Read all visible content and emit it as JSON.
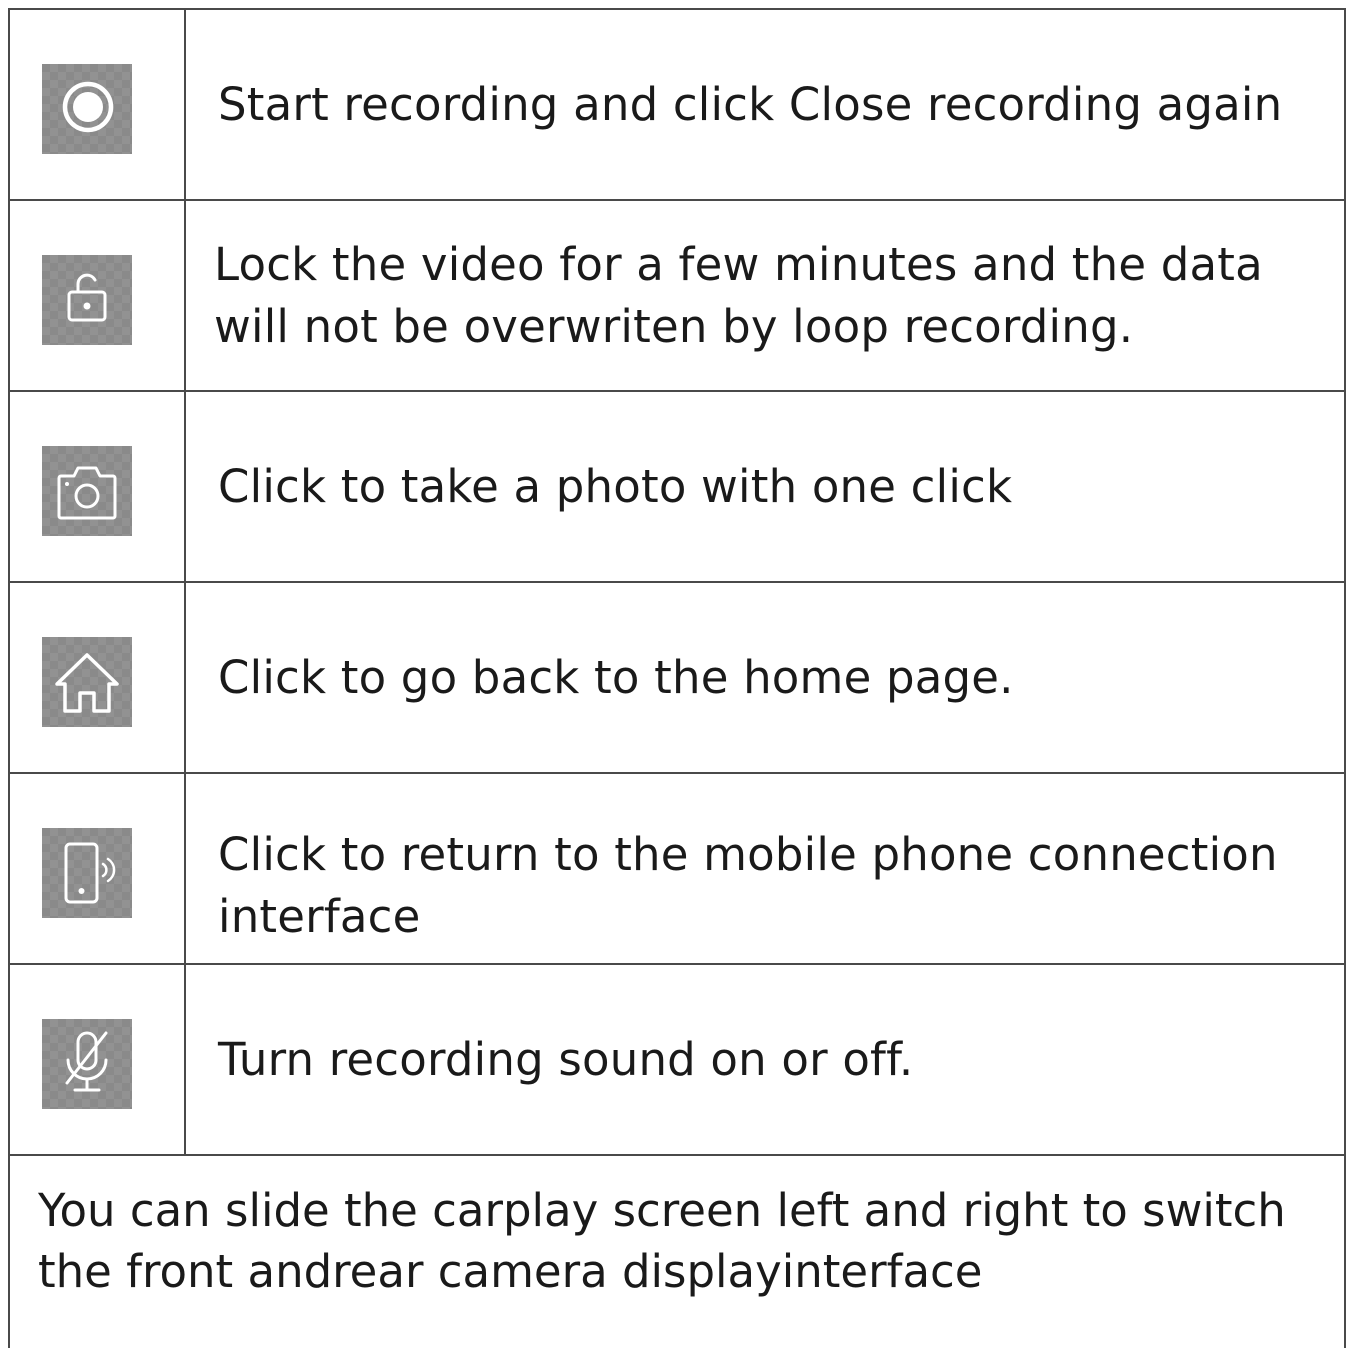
{
  "rows": [
    {
      "icon": "record-icon",
      "text": "Start recording and click Close recording again"
    },
    {
      "icon": "lock-icon",
      "text": "Lock the video for a few minutes and the data will not be overwriten by loop recording."
    },
    {
      "icon": "camera-icon",
      "text": "Click to take a photo with one click"
    },
    {
      "icon": "home-icon",
      "text": "Click to go back to the home page."
    },
    {
      "icon": "phone-connection-icon",
      "text": "Click to return to the mobile phone connection interface"
    },
    {
      "icon": "microphone-mute-icon",
      "text": "Turn recording sound on or off."
    }
  ],
  "footer": {
    "line1": "You can slide the carplay screen left and right to switch",
    "line2": "the front andrear camera displayinterface"
  },
  "colors": {
    "icon_background": "#8a8a8a",
    "icon_stroke": "#ffffff",
    "border": "#4a4a4a",
    "text": "#1a1a1a"
  }
}
